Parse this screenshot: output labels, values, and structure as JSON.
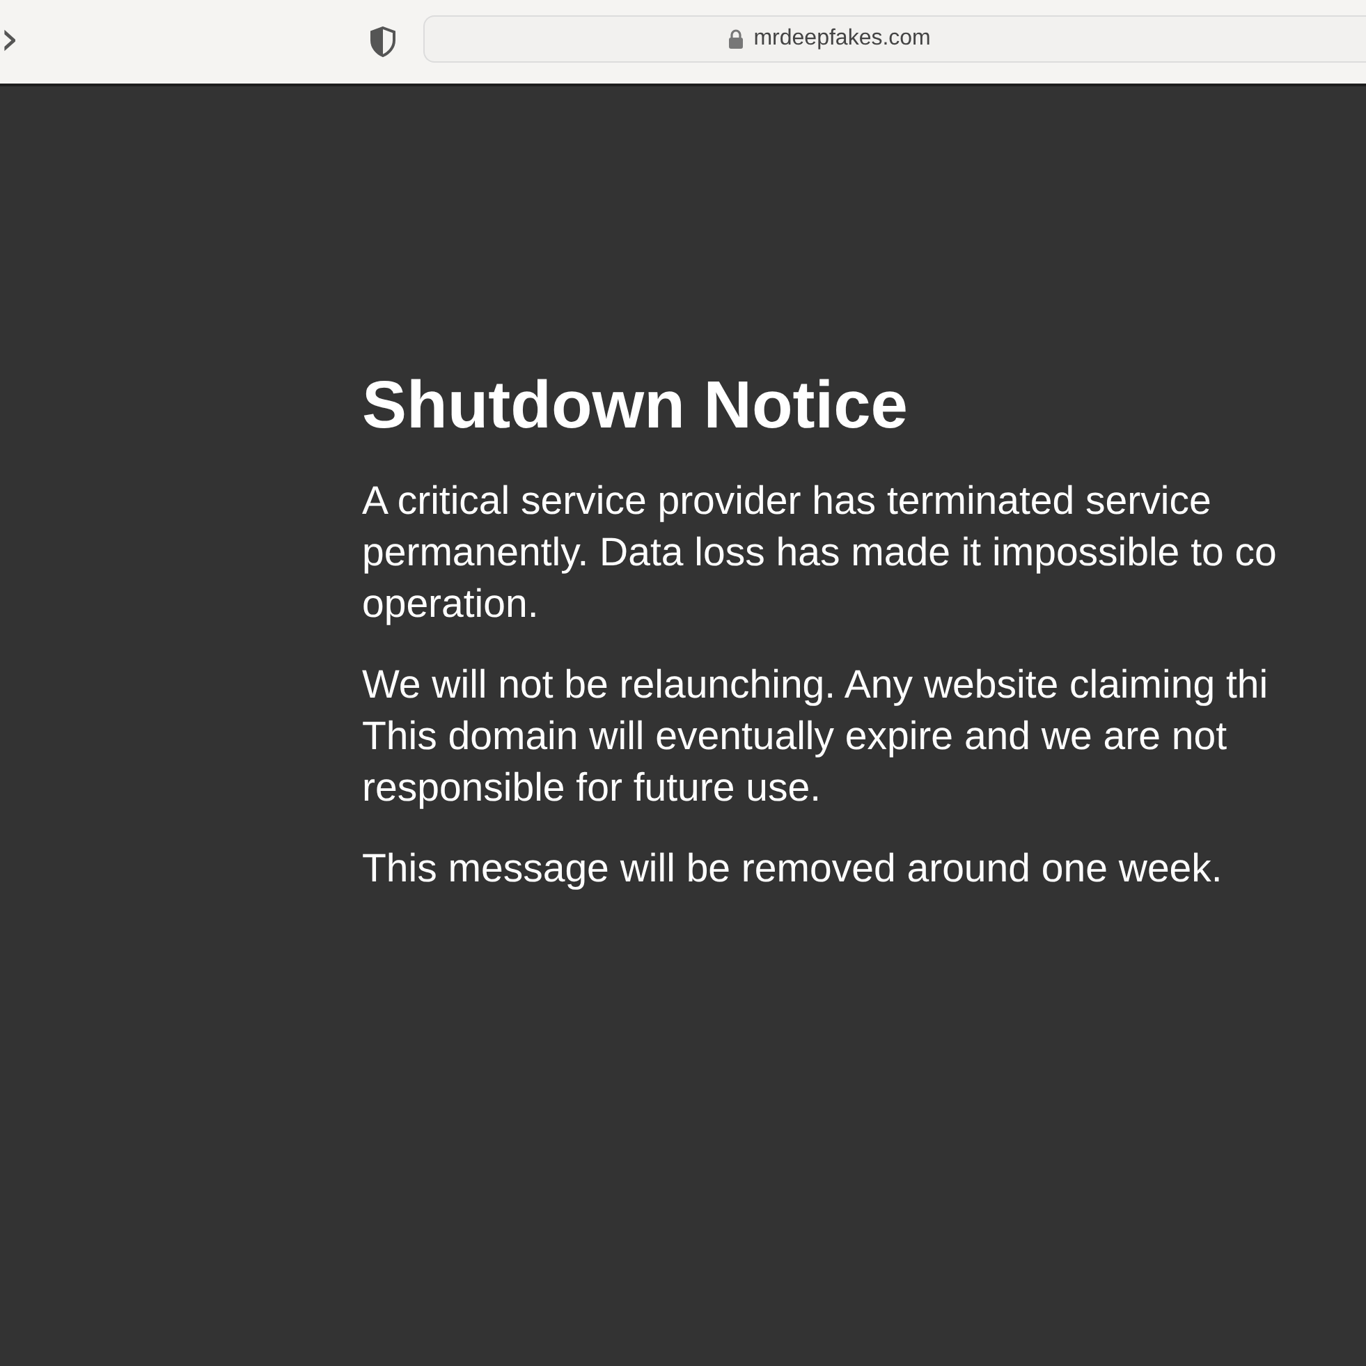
{
  "toolbar": {
    "forward": "›",
    "url": "mrdeepfakes.com"
  },
  "notice": {
    "title": "Shutdown Notice",
    "paragraphs": [
      {
        "lines": [
          "A critical service provider has terminated service",
          "permanently. Data loss has made it impossible to co",
          "operation."
        ]
      },
      {
        "lines": [
          "We will not be relaunching. Any website claiming thi",
          "This domain will eventually expire and we are not",
          "responsible for future use."
        ]
      },
      {
        "lines": [
          "This message will be removed around one week."
        ]
      }
    ]
  }
}
